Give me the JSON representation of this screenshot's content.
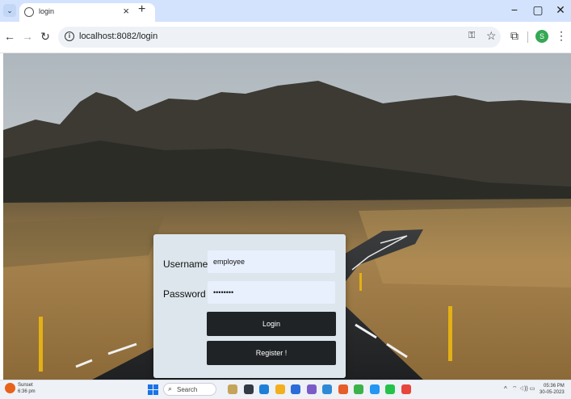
{
  "browser": {
    "tab_title": "login",
    "tab_close": "×",
    "new_tab": "+",
    "tab_control": "⌄",
    "window_controls": {
      "minimize": "−",
      "restore": "▢",
      "close": "✕"
    },
    "nav": {
      "back": "←",
      "forward": "→",
      "reload": "↻"
    },
    "url": "localhost:8082/login",
    "profile_initial": "S",
    "icons": [
      "tab-favicon",
      "info-icon",
      "key-icon",
      "star-icon",
      "extensions-icon",
      "profile-avatar",
      "kebab-menu-icon"
    ]
  },
  "login": {
    "username_label": "Username",
    "username_value": "employee",
    "password_label": "Password",
    "password_value": "••••••••",
    "login_button": "Login",
    "register_button": "Register !"
  },
  "taskbar": {
    "weather_title": "Sunset",
    "weather_time": "6:36 pm",
    "search_label": "Search",
    "tray_chevron": "^",
    "tray_icons": "⌔ ◁)) ▭",
    "clock_time": "05:36 PM",
    "clock_date": "30-05-2023",
    "pinned_colors": [
      "#c4a35a",
      "#333a44",
      "#1e7fd8",
      "#f2b01e",
      "#2b6cd8",
      "#7a5cc8",
      "#2f8ad6",
      "#e45d2b",
      "#3bb34a",
      "#2196f3",
      "#25c24a",
      "#e8453c"
    ]
  },
  "colors": {
    "tab_strip": "#d3e3fd",
    "card_background": "#dde6ec",
    "input_background": "#e8f0fe",
    "button_background": "#1f2326"
  }
}
